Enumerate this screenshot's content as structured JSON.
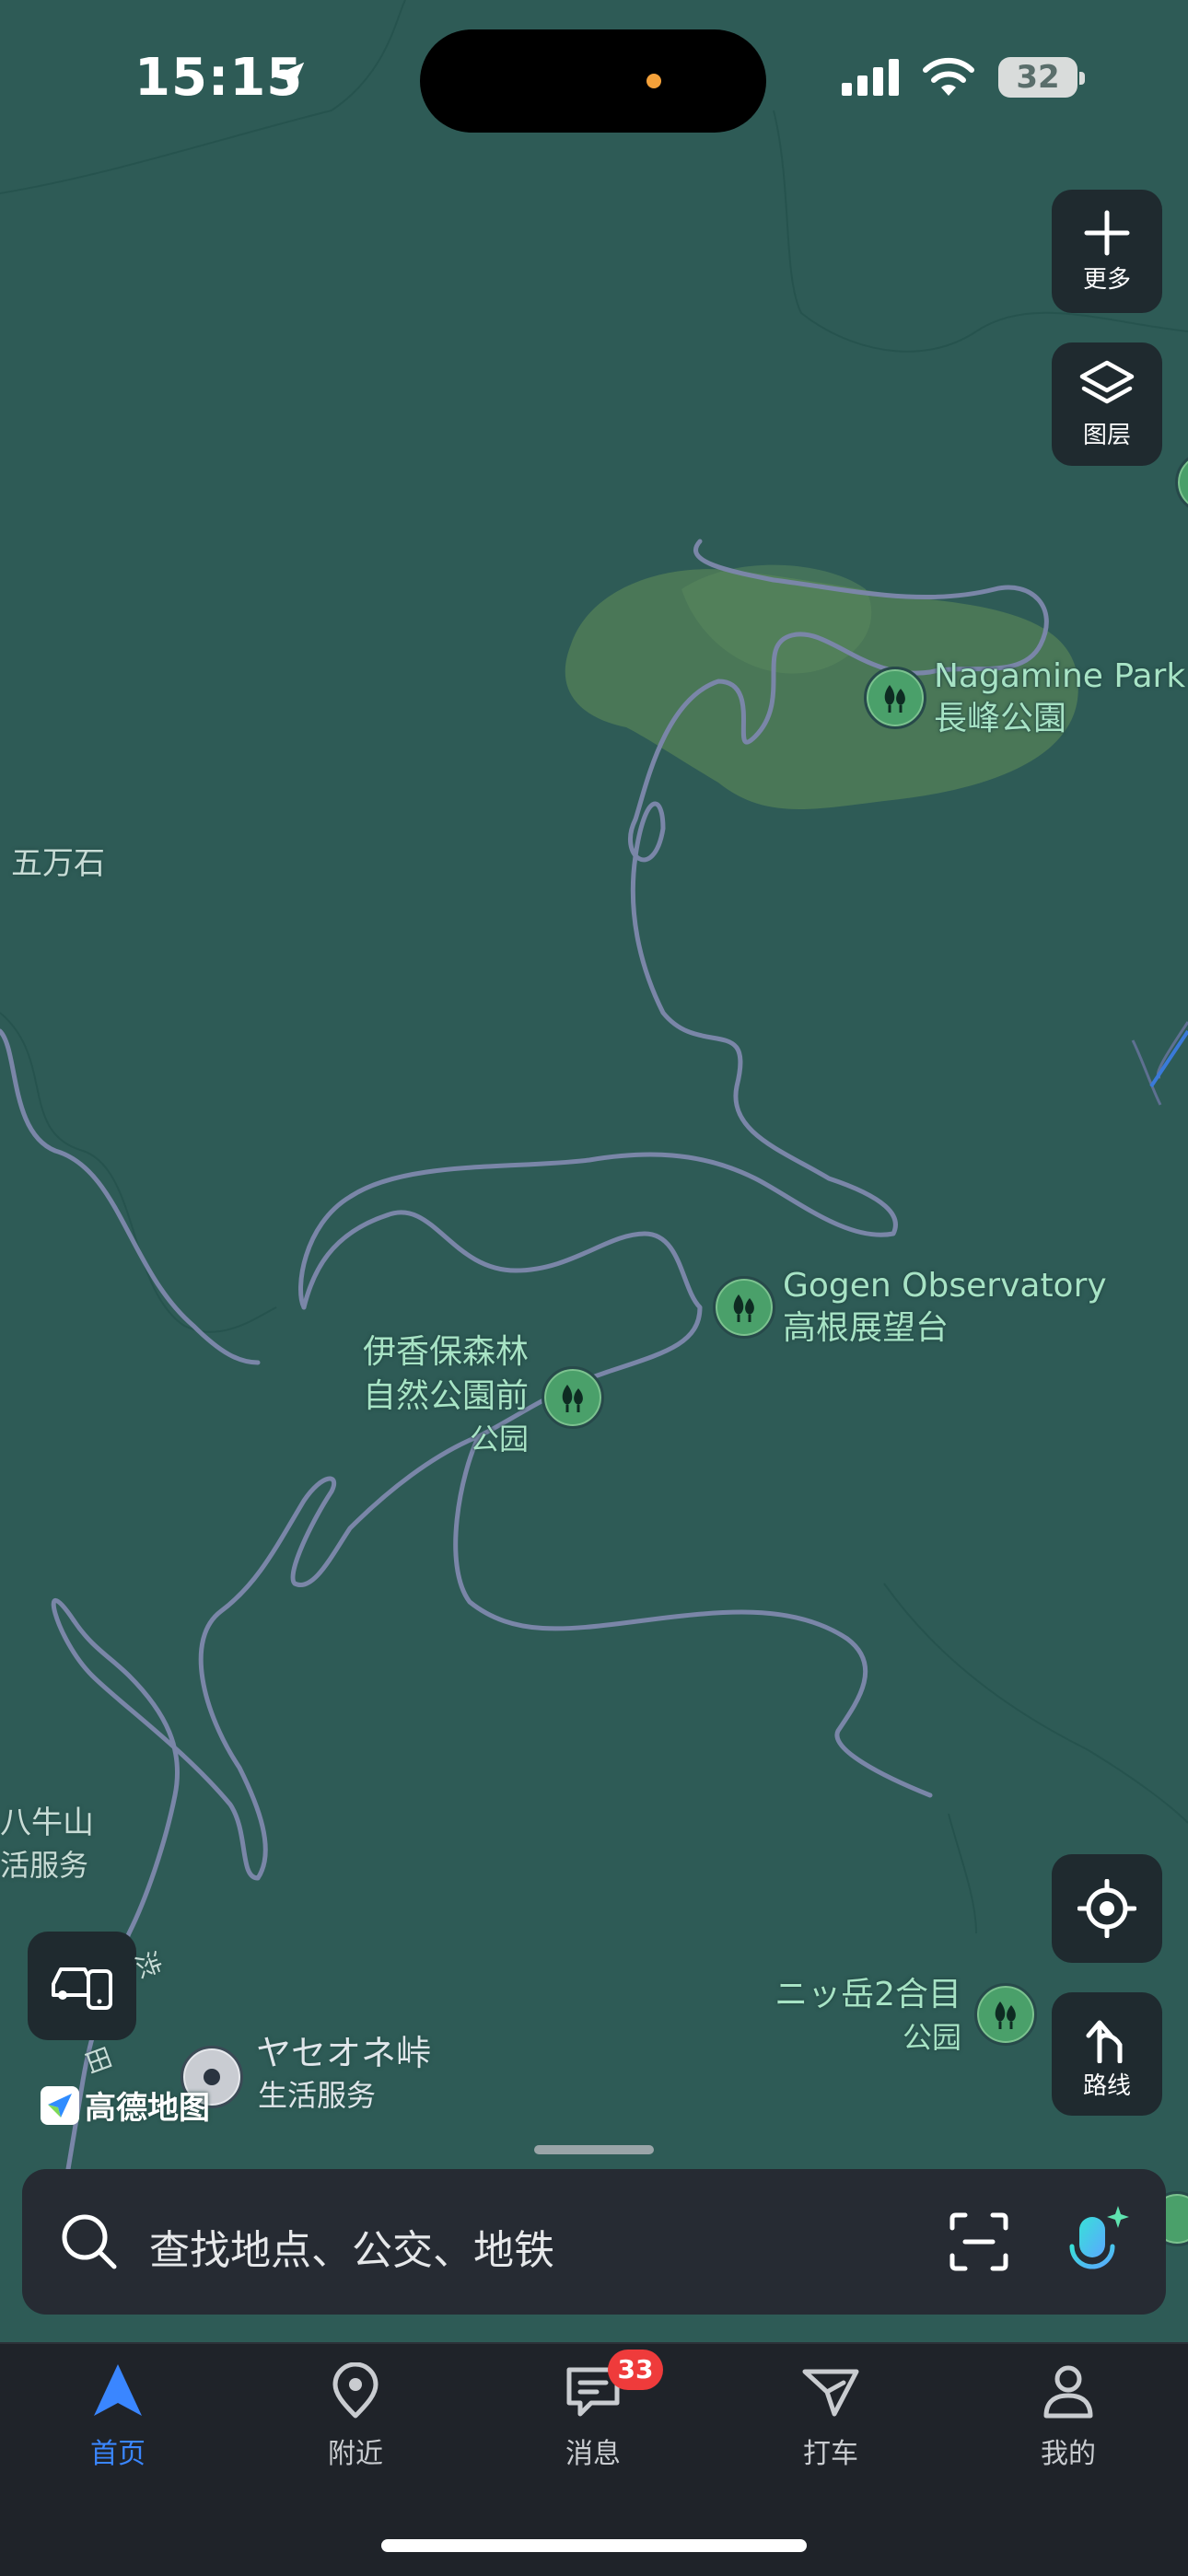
{
  "status_bar": {
    "time": "15:15",
    "battery": "32"
  },
  "map_controls": {
    "more_label": "更多",
    "layers_label": "图层",
    "route_label": "路线"
  },
  "map_labels": {
    "nagamine_en": "Nagamine Park",
    "nagamine_jp": "長峰公園",
    "gogen_en": "Gogen Observatory",
    "gogen_jp": "高根展望台",
    "ikaho_line1": "伊香保森林",
    "ikaho_line2": "自然公園前",
    "ikaho_line3": "公园",
    "gomangoku": "五万石",
    "yatsugatake_line1": "ニッ岳2合目",
    "yatsugatake_line2": "公园",
    "yaseone_name": "ヤセオネ峠",
    "yaseone_category": "生活服务",
    "left_mountain": "八牛山",
    "left_category": "活服务",
    "road_label_1": "渋",
    "road_label_2": "田"
  },
  "logo_text": "高德地图",
  "search": {
    "placeholder": "查找地点、公交、地铁"
  },
  "tabs": [
    {
      "label": "首页",
      "icon": "navigation-arrow-icon"
    },
    {
      "label": "附近",
      "icon": "location-pin-icon"
    },
    {
      "label": "消息",
      "icon": "message-icon"
    },
    {
      "label": "打车",
      "icon": "taxi-icon"
    },
    {
      "label": "我的",
      "icon": "profile-icon"
    }
  ],
  "messages_badge": "33",
  "colors": {
    "map_background": "#2e5b56",
    "road": "#7a86a8",
    "park_fill": "#4f7d57",
    "accent": "#3a86ff",
    "badge": "#ef3b3b"
  }
}
